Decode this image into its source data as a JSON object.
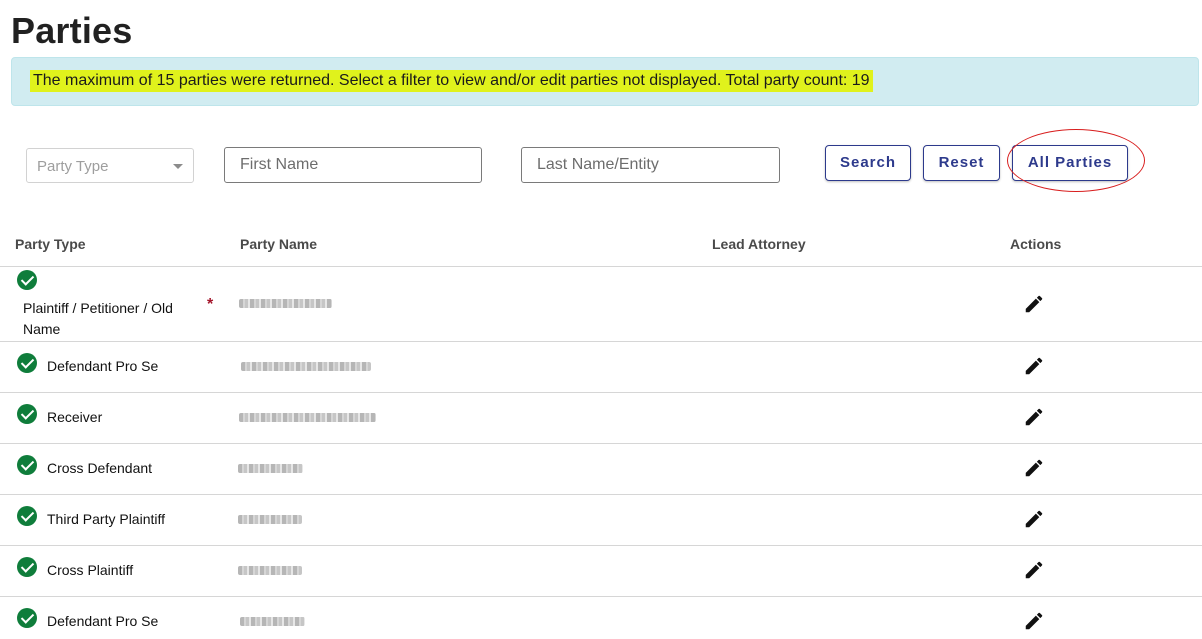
{
  "page": {
    "title": "Parties"
  },
  "alert": {
    "message": "The maximum of 15 parties were returned. Select a filter to view and/or edit parties not displayed. Total party count: 19"
  },
  "filters": {
    "party_type_placeholder": "Party Type",
    "first_name_placeholder": "First Name",
    "last_name_placeholder": "Last Name/Entity",
    "search_label": "Search",
    "reset_label": "Reset",
    "all_parties_label": "All Parties"
  },
  "table": {
    "headers": {
      "party_type": "Party Type",
      "party_name": "Party Name",
      "lead_attorney": "Lead Attorney",
      "actions": "Actions"
    },
    "rows": [
      {
        "party_type": "Plaintiff / Petitioner / Old Name",
        "required_marker": "*",
        "status": "active",
        "party_name_redacted": true
      },
      {
        "party_type": "Defendant Pro Se",
        "status": "active",
        "party_name_redacted": true
      },
      {
        "party_type": "Receiver",
        "status": "active",
        "party_name_redacted": true
      },
      {
        "party_type": "Cross Defendant",
        "status": "active",
        "party_name_redacted": true
      },
      {
        "party_type": "Third Party Plaintiff",
        "status": "active",
        "party_name_redacted": true
      },
      {
        "party_type": "Cross Plaintiff",
        "status": "active",
        "party_name_redacted": true
      },
      {
        "party_type": "Defendant Pro Se",
        "status": "active",
        "party_name_redacted": true
      }
    ]
  },
  "icons": {
    "status": "check-circle-icon",
    "action": "pencil-edit-icon"
  },
  "colors": {
    "accent": "#2d3a8c",
    "alert_bg": "#d1ecf1",
    "highlight": "#e0f21c",
    "success": "#0f7d3b",
    "annotation": "#d81e1e",
    "required": "#a4162b"
  }
}
